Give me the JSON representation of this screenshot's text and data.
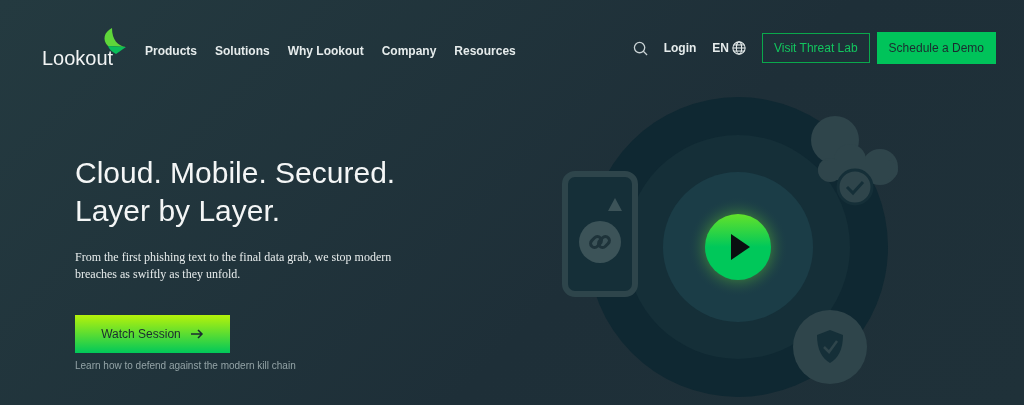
{
  "header": {
    "logo": "Lookout",
    "nav": [
      {
        "label": "Products"
      },
      {
        "label": "Solutions"
      },
      {
        "label": "Why Lookout"
      },
      {
        "label": "Company"
      },
      {
        "label": "Resources"
      }
    ],
    "login": "Login",
    "language": "EN",
    "secondary_button": "Visit Threat Lab",
    "primary_button": "Schedule a Demo"
  },
  "hero": {
    "headline_lines": [
      "Cloud. Mobile. Secured.",
      "Layer by Layer."
    ],
    "description": "From the first phishing text to the final data grab, we stop modern breaches as swiftly as they unfold.",
    "cta": "Watch Session",
    "caption": "Learn how to defend against the modern kill chain"
  }
}
